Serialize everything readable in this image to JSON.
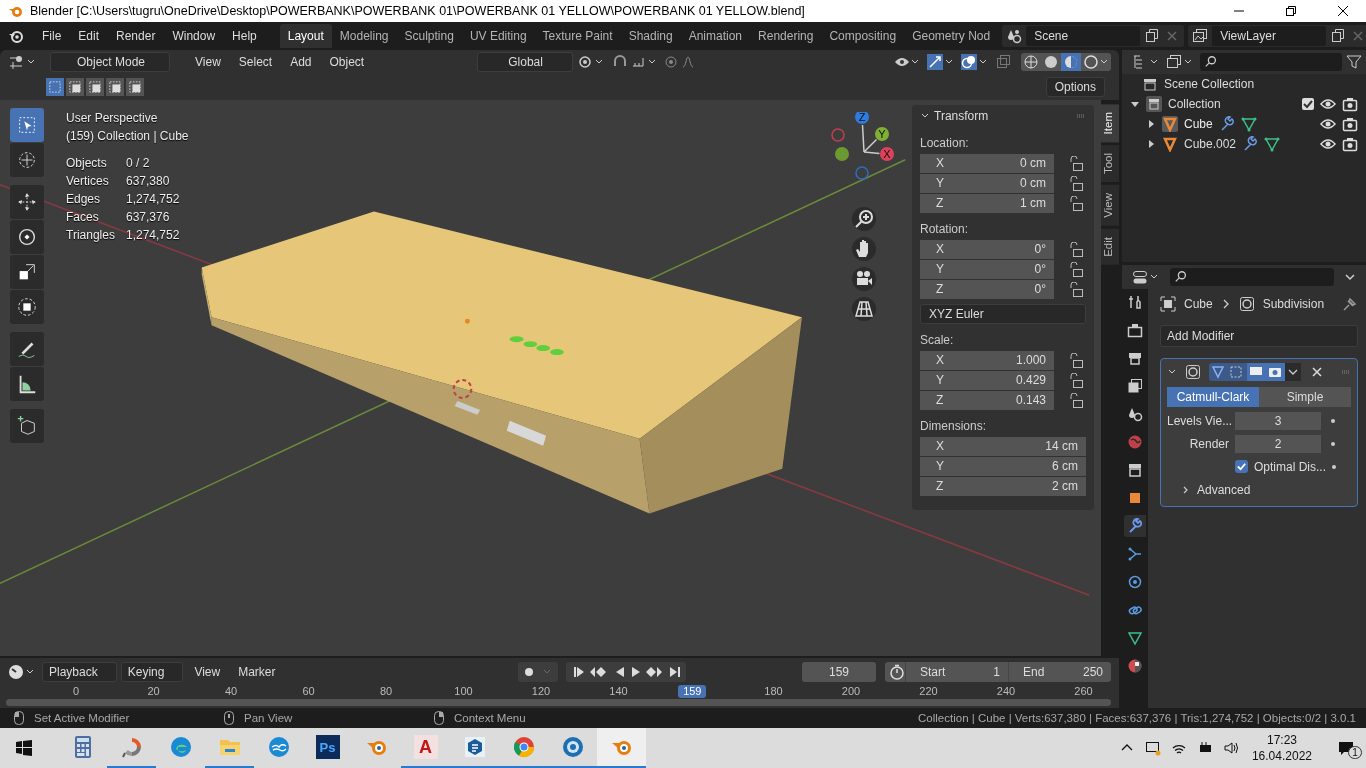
{
  "window": {
    "title": "Blender [C:\\Users\\tugru\\OneDrive\\Desktop\\POWERBANK\\POWERBANK 01\\POWERBANK 01 YELLOW\\POWERBANK 01 YELLOW.blend]"
  },
  "menu": [
    "File",
    "Edit",
    "Render",
    "Window",
    "Help"
  ],
  "workspaces": [
    {
      "label": "Layout",
      "selected": true
    },
    {
      "label": "Modeling",
      "selected": false
    },
    {
      "label": "Sculpting",
      "selected": false
    },
    {
      "label": "UV Editing",
      "selected": false
    },
    {
      "label": "Texture Paint",
      "selected": false
    },
    {
      "label": "Shading",
      "selected": false
    },
    {
      "label": "Animation",
      "selected": false
    },
    {
      "label": "Rendering",
      "selected": false
    },
    {
      "label": "Compositing",
      "selected": false
    },
    {
      "label": "Geometry Nod",
      "selected": false
    }
  ],
  "scene": "Scene",
  "view_layer": "ViewLayer",
  "viewport": {
    "mode": "Object Mode",
    "menus": [
      "View",
      "Select",
      "Add",
      "Object"
    ],
    "orientation": "Global",
    "options": "Options",
    "select_modes": [
      {
        "selected": true
      },
      {
        "selected": false
      },
      {
        "selected": false
      },
      {
        "selected": false
      },
      {
        "selected": false
      }
    ],
    "tools": [
      {
        "kind": "select",
        "selected": true
      },
      {
        "kind": "cursor",
        "selected": false
      },
      {
        "kind": "move",
        "selected": false
      },
      {
        "kind": "rotate",
        "selected": false
      },
      {
        "kind": "scale",
        "selected": false
      },
      {
        "kind": "transform",
        "selected": false
      },
      {
        "kind": "annotate",
        "selected": false
      },
      {
        "kind": "measure",
        "selected": false
      },
      {
        "kind": "add-cube",
        "selected": false
      }
    ],
    "view_name": "User Perspective",
    "context": "(159) Collection | Cube",
    "stats": [
      {
        "label": "Objects",
        "value": "0 / 2"
      },
      {
        "label": "Vertices",
        "value": "637,380"
      },
      {
        "label": "Edges",
        "value": "1,274,752"
      },
      {
        "label": "Faces",
        "value": "637,376"
      },
      {
        "label": "Triangles",
        "value": "1,274,752"
      }
    ],
    "gizmo": [
      {
        "label": "Z",
        "color": "#2e7ce0"
      },
      {
        "label": "Y",
        "color": "#7fb034"
      },
      {
        "label": "X",
        "color": "#e0405a"
      }
    ],
    "sidebar_tabs": [
      {
        "label": "Item",
        "selected": true
      },
      {
        "label": "Tool",
        "selected": false
      },
      {
        "label": "View",
        "selected": false
      },
      {
        "label": "Edit",
        "selected": false
      }
    ],
    "transform": {
      "title": "Transform",
      "rotation_mode": "XYZ Euler",
      "groups": [
        {
          "label": "Location:",
          "lockable": true,
          "fields": [
            {
              "axis": "X",
              "value": "0 cm"
            },
            {
              "axis": "Y",
              "value": "0 cm"
            },
            {
              "axis": "Z",
              "value": "1 cm"
            }
          ]
        },
        {
          "label": "Rotation:",
          "lockable": true,
          "fields": [
            {
              "axis": "X",
              "value": "0°"
            },
            {
              "axis": "Y",
              "value": "0°"
            },
            {
              "axis": "Z",
              "value": "0°"
            }
          ]
        },
        {
          "label": "Scale:",
          "lockable": true,
          "fields": [
            {
              "axis": "X",
              "value": "1.000"
            },
            {
              "axis": "Y",
              "value": "0.429"
            },
            {
              "axis": "Z",
              "value": "0.143"
            }
          ]
        },
        {
          "label": "Dimensions:",
          "lockable": false,
          "fields": [
            {
              "axis": "X",
              "value": "14 cm"
            },
            {
              "axis": "Y",
              "value": "6 cm"
            },
            {
              "axis": "Z",
              "value": "2 cm"
            }
          ]
        }
      ]
    }
  },
  "outliner": {
    "root": "Scene Collection",
    "items": [
      {
        "label": "Collection",
        "expanded": true,
        "checked": true,
        "children": [
          {
            "label": "Cube",
            "expanded": false,
            "selected": true
          },
          {
            "label": "Cube.002",
            "expanded": false,
            "selected": false
          }
        ]
      }
    ]
  },
  "properties": {
    "tabs": [
      {
        "kind": "tool",
        "selected": false
      },
      {
        "kind": "render",
        "selected": false
      },
      {
        "kind": "output",
        "selected": false
      },
      {
        "kind": "view-layer",
        "selected": false
      },
      {
        "kind": "scene",
        "selected": false
      },
      {
        "kind": "world",
        "selected": false
      },
      {
        "kind": "collection",
        "selected": false
      },
      {
        "kind": "object",
        "selected": false
      },
      {
        "kind": "modifiers",
        "selected": true
      },
      {
        "kind": "particles",
        "selected": false
      },
      {
        "kind": "physics",
        "selected": false
      },
      {
        "kind": "constraints",
        "selected": false
      },
      {
        "kind": "data",
        "selected": false
      },
      {
        "kind": "material",
        "selected": false
      }
    ],
    "object": "Cube",
    "modifier": "Subdivision",
    "add_modifier": "Add Modifier",
    "algorithms": [
      {
        "label": "Catmull-Clark",
        "selected": true
      },
      {
        "label": "Simple",
        "selected": false
      }
    ],
    "levels": [
      {
        "label": "Levels Vie...",
        "value": "3"
      },
      {
        "label": "Render",
        "value": "2"
      }
    ],
    "optimal": {
      "label": "Optimal Dis...",
      "checked": true
    },
    "advanced": {
      "label": "Advanced",
      "expanded": false
    }
  },
  "timeline": {
    "menus": [
      "Playback",
      "Keying",
      "View",
      "Marker"
    ],
    "current": "159",
    "playhead": "159",
    "start_label": "Start",
    "start": "1",
    "end_label": "End",
    "end": "250",
    "ticks": [
      "0",
      "20",
      "40",
      "60",
      "80",
      "100",
      "120",
      "140",
      "180",
      "200",
      "220",
      "240",
      "260"
    ]
  },
  "status": {
    "hints": [
      "Set Active Modifier",
      "Pan View",
      "Context Menu"
    ],
    "stats": "Collection | Cube | Verts:637,380 | Faces:637,376 | Tris:1,274,752 | Objects:0/2 | 3.0.1"
  },
  "taskbar": {
    "apps": [
      {
        "kind": "calculator",
        "running": false,
        "active": false
      },
      {
        "kind": "swirl",
        "running": true,
        "active": false
      },
      {
        "kind": "edge",
        "running": false,
        "active": false
      },
      {
        "kind": "folder",
        "running": true,
        "active": false
      },
      {
        "kind": "birds",
        "running": false,
        "active": false
      },
      {
        "kind": "ps",
        "glyph": "Ps",
        "running": false,
        "active": false
      },
      {
        "kind": "blender",
        "running": false,
        "active": false
      },
      {
        "kind": "autocad",
        "glyph": "A",
        "running": true,
        "active": false
      },
      {
        "kind": "cube",
        "running": true,
        "active": false
      },
      {
        "kind": "chrome",
        "running": true,
        "active": false
      },
      {
        "kind": "aperture",
        "running": true,
        "active": false
      },
      {
        "kind": "blender",
        "running": true,
        "active": true
      }
    ],
    "time": "17:23",
    "date": "16.04.2022",
    "notifications": "1"
  }
}
